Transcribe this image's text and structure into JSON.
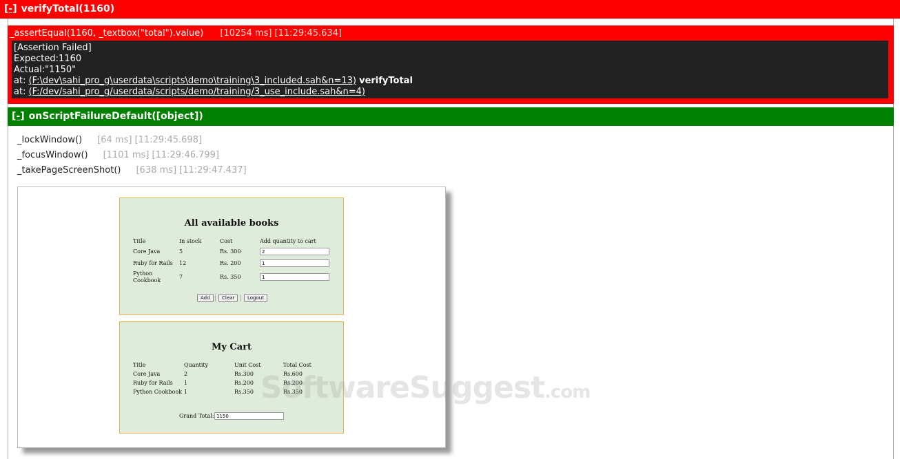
{
  "top_bar": {
    "toggle": "[-]",
    "title": "verifyTotal(1160)"
  },
  "assert": {
    "call": "_assertEqual(1160, _textbox(\"total\").value)",
    "timing": "[10254 ms] [11:29:45.634]",
    "log": {
      "line1": "[Assertion Failed]",
      "line2": "Expected:1160",
      "line3": "Actual:\"1150\"",
      "at_label": "at: ",
      "link1": "(F:\\dev\\sahi_pro_g\\userdata\\scripts\\demo\\training\\3_included.sah&n=13)",
      "fn1": "verifyTotal",
      "link2": "(F:/dev/sahi_pro_g/userdata/scripts/demo/training/3_use_include.sah&n=4)"
    }
  },
  "failure": {
    "toggle": "[-]",
    "title": "onScriptFailureDefault([object])",
    "steps": [
      {
        "call": "_lockWindow()",
        "time": "[64 ms] [11:29:45.698]"
      },
      {
        "call": "_focusWindow()",
        "time": "[1101 ms] [11:29:46.799]"
      },
      {
        "call": "_takePageScreenShot()",
        "time": "[638 ms] [11:29:47.437]"
      }
    ]
  },
  "screenshot": {
    "books": {
      "heading": "All available books",
      "headers": [
        "Title",
        "In stock",
        "Cost",
        "Add quantity to cart"
      ],
      "rows": [
        {
          "title": "Core Java",
          "stock": "5",
          "cost": "Rs. 300",
          "qty": "2"
        },
        {
          "title": "Ruby for Rails",
          "stock": "12",
          "cost": "Rs. 200",
          "qty": "1"
        },
        {
          "title_l1": "Python",
          "title_l2": "Cookbook",
          "stock": "7",
          "cost": "Rs. 350",
          "qty": "1"
        }
      ],
      "buttons": {
        "add": "Add",
        "clear": "Clear",
        "logout": "Logout"
      }
    },
    "cart": {
      "heading": "My Cart",
      "headers": [
        "Title",
        "Quantity",
        "Unit Cost",
        "Total Cost"
      ],
      "rows": [
        {
          "title": "Core Java",
          "qty": "2",
          "unit": "Rs.300",
          "total": "Rs.600"
        },
        {
          "title": "Ruby for Rails",
          "qty": "1",
          "unit": "Rs.200",
          "total": "Rs.200"
        },
        {
          "title": "Python Cookbook",
          "qty": "1",
          "unit": "Rs.350",
          "total": "Rs.350"
        }
      ],
      "grand_total_label": "Grand Total:",
      "grand_total_value": "1150"
    }
  },
  "watermark": {
    "main": "SoftwareSuggest",
    "suffix": ".com"
  }
}
